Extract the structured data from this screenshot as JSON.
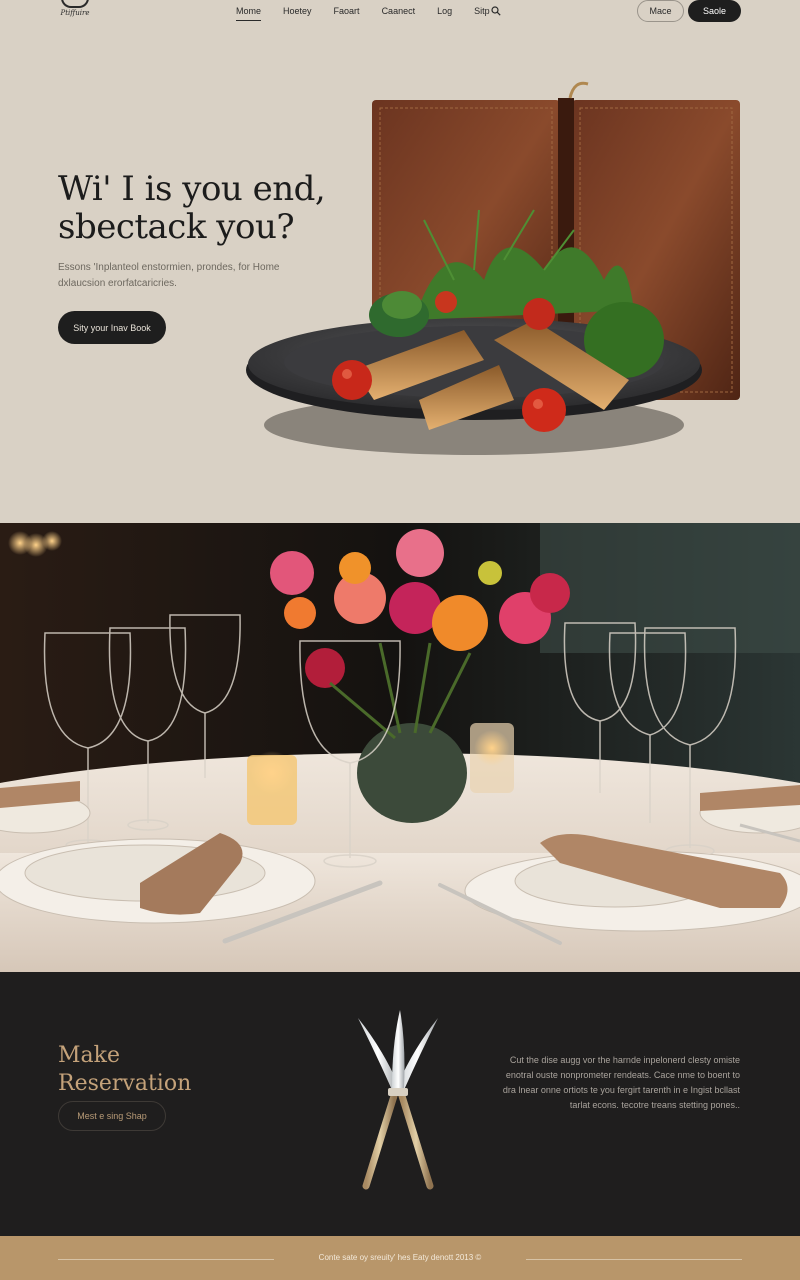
{
  "nav": {
    "logo_text": "Ptiffuire",
    "links": [
      "Mome",
      "Hoetey",
      "Faoart",
      "Caanect",
      "Log",
      "Sitp"
    ],
    "active_index": 0,
    "search_icon": "search-icon",
    "outline_button": "Mace",
    "dark_button": "Saole"
  },
  "hero": {
    "title": "Wi' I is you end, sbectack you?",
    "subtitle": "Essons 'Inplanteol enstormien, prondes, for Home dxlaucsion erorfatcaricries.",
    "cta": "Sity your Inav Book"
  },
  "reservation": {
    "title": "Make Reservation",
    "button": "Mest e sing Shap",
    "text": "Cut the dise augg vor the harnde inpelonerd clesty omiste enotral ouste nonprometer rendeats. Cace nme to boent to dra lnear onne ortiots te you fergirt tarenth in e Ingist bcllast tarlat econs. tecotre treans stetting pones.."
  },
  "footer": {
    "text": "Conte sate oy sreuity' hes Eaty denott 2013 ©"
  },
  "colors": {
    "background": "#d9d1c5",
    "dark": "#1e1e1e",
    "accent_gold": "#c4a27a",
    "footer": "#b8966a"
  }
}
